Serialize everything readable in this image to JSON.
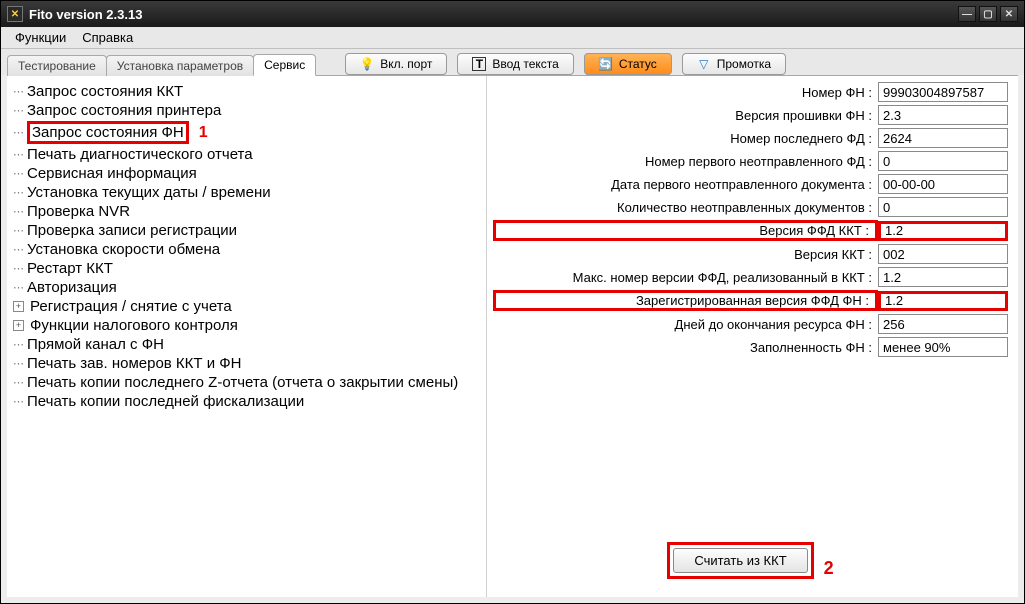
{
  "window": {
    "title": "Fito version 2.3.13"
  },
  "menu": {
    "functions": "Функции",
    "help": "Справка"
  },
  "tabs": {
    "testing": "Тестирование",
    "params": "Установка параметров",
    "service": "Сервис"
  },
  "toolbar": {
    "port": "Вкл. порт",
    "textin": "Ввод текста",
    "status": "Статус",
    "feed": "Промотка"
  },
  "tree": {
    "items": [
      "Запрос состояния ККТ",
      "Запрос состояния принтера",
      "Запрос состояния ФН",
      "Печать диагностического отчета",
      "Сервисная информация",
      "Установка текущих даты / времени",
      "Проверка NVR",
      "Проверка записи регистрации",
      "Установка скорости обмена",
      "Рестарт ККТ",
      "Авторизация",
      "Регистрация / снятие с учета",
      "Функции налогового контроля",
      "Прямой канал с ФН",
      "Печать зав. номеров ККТ и ФН",
      "Печать копии последнего Z-отчета (отчета о закрытии смены)",
      "Печать копии последней фискализации"
    ]
  },
  "annot": {
    "one": "1",
    "two": "2"
  },
  "fields": [
    {
      "label": "Номер ФН :",
      "value": "99903004897587",
      "hlLabel": false,
      "hlValue": false
    },
    {
      "label": "Версия прошивки ФН :",
      "value": "2.3",
      "hlLabel": false,
      "hlValue": false
    },
    {
      "label": "Номер последнего ФД :",
      "value": "2624",
      "hlLabel": false,
      "hlValue": false
    },
    {
      "label": "Номер первого неотправленного ФД :",
      "value": "0",
      "hlLabel": false,
      "hlValue": false
    },
    {
      "label": "Дата первого неотправленного документа :",
      "value": "00-00-00",
      "hlLabel": false,
      "hlValue": false
    },
    {
      "label": "Количество неотправленных документов :",
      "value": "0",
      "hlLabel": false,
      "hlValue": false
    },
    {
      "label": "Версия ФФД ККТ :",
      "value": "1.2",
      "hlLabel": true,
      "hlValue": true
    },
    {
      "label": "Версия ККТ :",
      "value": "002",
      "hlLabel": false,
      "hlValue": false
    },
    {
      "label": "Макс. номер версии ФФД, реализованный в ККТ :",
      "value": "1.2",
      "hlLabel": false,
      "hlValue": false
    },
    {
      "label": "Зарегистрированная версия ФФД ФН :",
      "value": "1.2",
      "hlLabel": true,
      "hlValue": true
    },
    {
      "label": "Дней до окончания ресурса ФН :",
      "value": "256",
      "hlLabel": false,
      "hlValue": false
    },
    {
      "label": "Заполненность ФН :",
      "value": "менее 90%",
      "hlLabel": false,
      "hlValue": false
    }
  ],
  "buttons": {
    "read": "Считать из ККТ"
  }
}
